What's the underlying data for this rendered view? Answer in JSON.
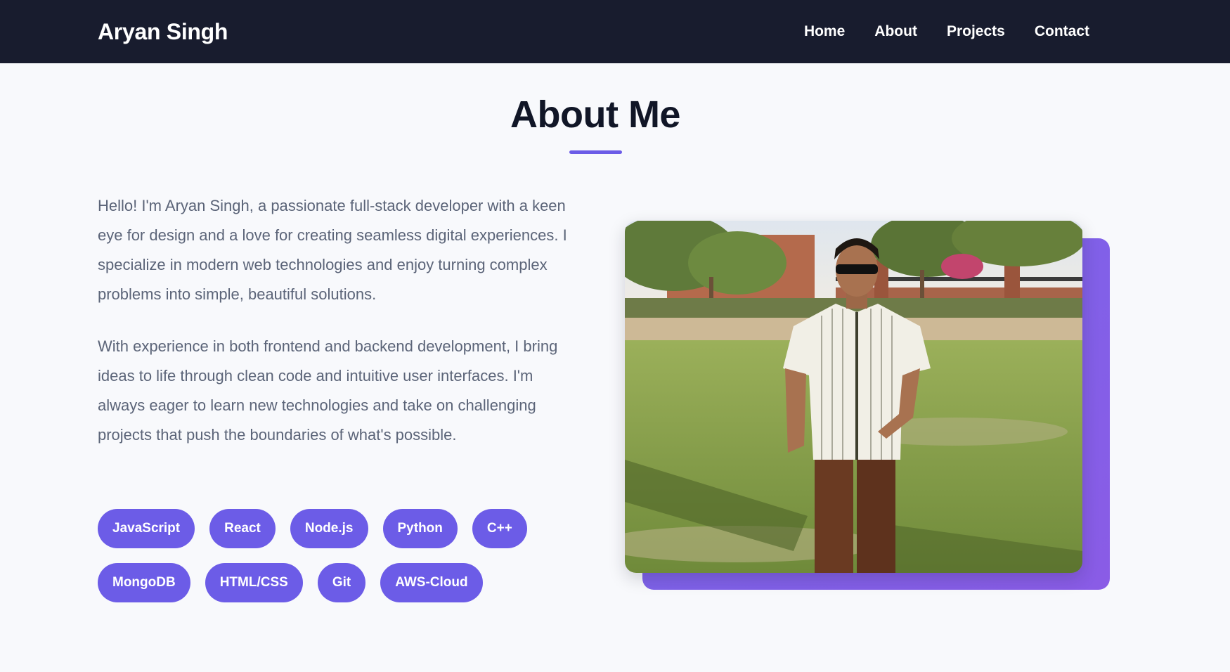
{
  "nav": {
    "brand": "Aryan Singh",
    "links": [
      "Home",
      "About",
      "Projects",
      "Contact"
    ]
  },
  "about": {
    "title": "About Me",
    "paragraphs": [
      "Hello! I'm Aryan Singh, a passionate full-stack developer with a keen eye for design and a love for creating seamless digital experiences. I specialize in modern web technologies and enjoy turning complex problems into simple, beautiful solutions.",
      "With experience in both frontend and backend development, I bring ideas to life through clean code and intuitive user interfaces. I'm always eager to learn new technologies and take on challenging projects that push the boundaries of what's possible."
    ],
    "skills": [
      "JavaScript",
      "React",
      "Node.js",
      "Python",
      "C++",
      "MongoDB",
      "HTML/CSS",
      "Git",
      "AWS-Cloud"
    ]
  },
  "colors": {
    "navbar_bg": "#181c2e",
    "accent": "#6c5ce7",
    "page_bg": "#f8f9fc",
    "body_text": "#5b6478",
    "heading": "#111627"
  }
}
